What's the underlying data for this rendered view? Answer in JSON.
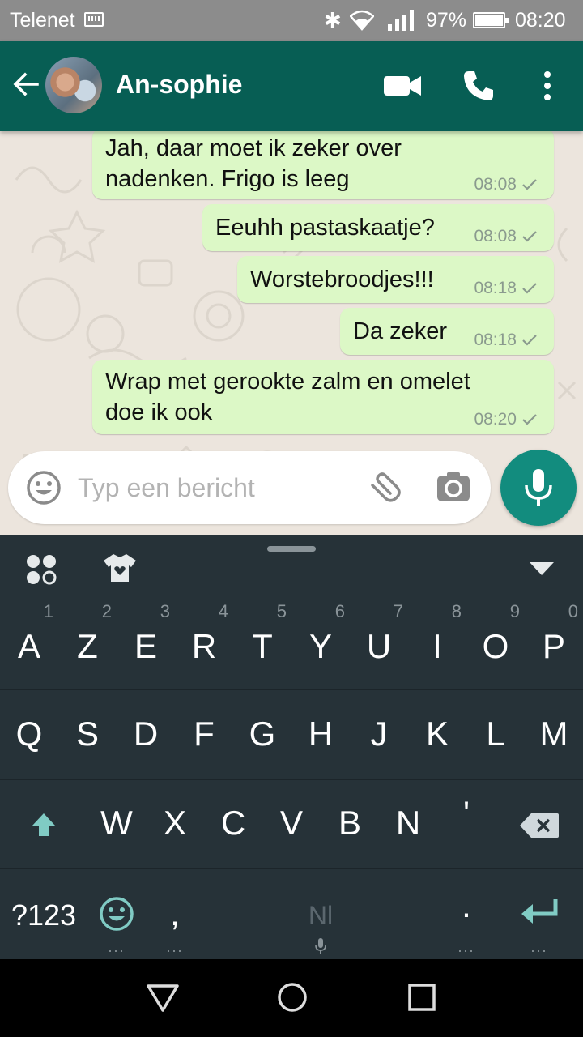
{
  "status_bar": {
    "carrier": "Telenet",
    "battery_pct": "97%",
    "time": "08:20",
    "icons": [
      "keyboard-icon",
      "bluetooth-icon",
      "wifi-icon",
      "signal-icon",
      "battery-icon"
    ]
  },
  "header": {
    "contact_name": "An-sophie",
    "icons": [
      "back-arrow-icon",
      "avatar",
      "video-call-icon",
      "phone-icon",
      "more-vert-icon"
    ]
  },
  "messages": [
    {
      "text": "Jah, daar moet ik zeker over\nnadenken. Frigo is leeg",
      "time": "08:08",
      "status": "sent"
    },
    {
      "text": "Eeuhh pastaskaatje?",
      "time": "08:08",
      "status": "sent"
    },
    {
      "text": "Worstebroodjes!!!",
      "time": "08:18",
      "status": "sent"
    },
    {
      "text": "Da zeker",
      "time": "08:18",
      "status": "sent"
    },
    {
      "text": "Wrap met gerookte zalm en omelet\ndoe ik ook",
      "time": "08:20",
      "status": "sent"
    }
  ],
  "composer": {
    "placeholder": "Typ een bericht",
    "value": ""
  },
  "colors": {
    "header": "#075e54",
    "accent": "#128c7e",
    "bubble_out": "#dcf8c6",
    "chat_bg": "#ece5dd",
    "keyboard_bg": "#263238"
  },
  "keyboard": {
    "row1": [
      {
        "k": "A",
        "h": "1"
      },
      {
        "k": "Z",
        "h": "2"
      },
      {
        "k": "E",
        "h": "3"
      },
      {
        "k": "R",
        "h": "4"
      },
      {
        "k": "T",
        "h": "5"
      },
      {
        "k": "Y",
        "h": "6"
      },
      {
        "k": "U",
        "h": "7"
      },
      {
        "k": "I",
        "h": "8"
      },
      {
        "k": "O",
        "h": "9"
      },
      {
        "k": "P",
        "h": "0"
      }
    ],
    "row2": [
      "Q",
      "S",
      "D",
      "F",
      "G",
      "H",
      "J",
      "K",
      "L",
      "M"
    ],
    "row3": [
      "W",
      "X",
      "C",
      "V",
      "B",
      "N",
      "'"
    ],
    "sym_label": "?123",
    "comma": ",",
    "lang_label": "Nl",
    "period": ".",
    "dots": "..."
  }
}
